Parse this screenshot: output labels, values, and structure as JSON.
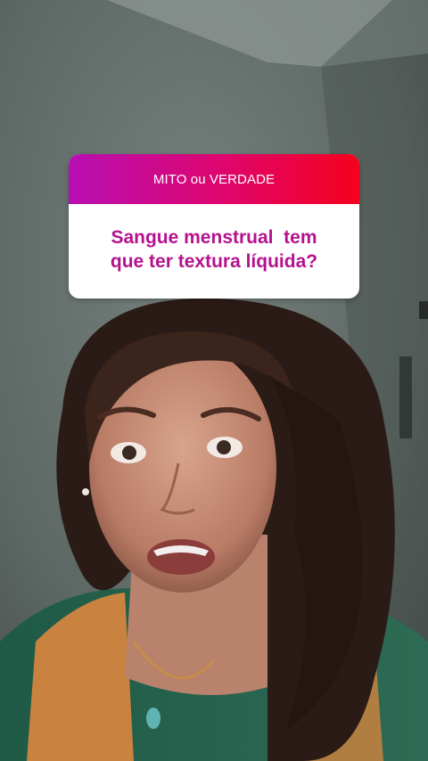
{
  "question_sticker": {
    "header": "MITO ou VERDADE",
    "question": "Sangue menstrual  tem\nque ter textura líquida?",
    "header_gradient_start": "#b80fb4",
    "header_gradient_end": "#f5021c",
    "question_color": "#b5128e"
  }
}
